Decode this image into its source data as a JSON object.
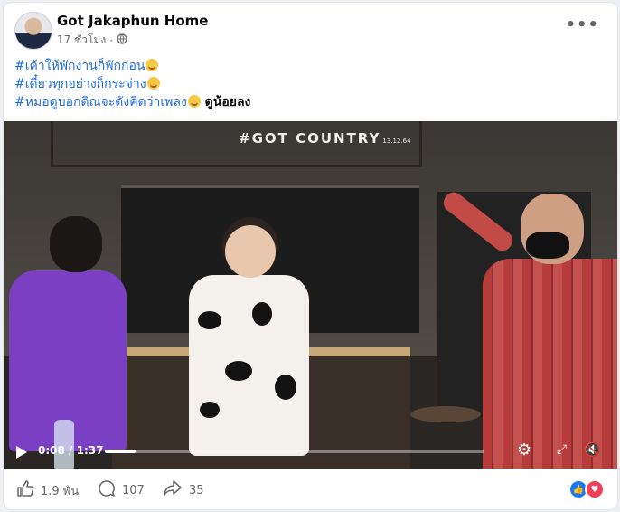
{
  "post": {
    "author": "Got Jakaphun Home",
    "time": "17 ชั่วโมง",
    "audience_icon": "globe-icon",
    "more_icon": "more-options-icon",
    "caption_lines": [
      {
        "tag": "#เค้าให้พักงานก็พักก่อน",
        "emoji": "grinning-emoji",
        "extra": ""
      },
      {
        "tag": "#เดี๋ยวทุกอย่างก็กระจ่าง",
        "emoji": "grinning-emoji",
        "extra": ""
      },
      {
        "tag": "#หมอดูบอกดิณจะดังคิดว่าเพลง",
        "emoji": "grinning-emoji",
        "extra": " ดูน้อยลง"
      }
    ]
  },
  "video": {
    "overlay_title": "#GOT COUNTRY",
    "overlay_date": "13.12.64",
    "current_time": "0:08",
    "duration": "1:37",
    "time_separator": " / ",
    "progress_fraction": 0.082
  },
  "stats": {
    "likes": "1.9 พัน",
    "comments": "107",
    "shares": "35"
  },
  "colors": {
    "link": "#216fdb",
    "like_blue": "#1877f2",
    "love_red": "#f33e58"
  }
}
